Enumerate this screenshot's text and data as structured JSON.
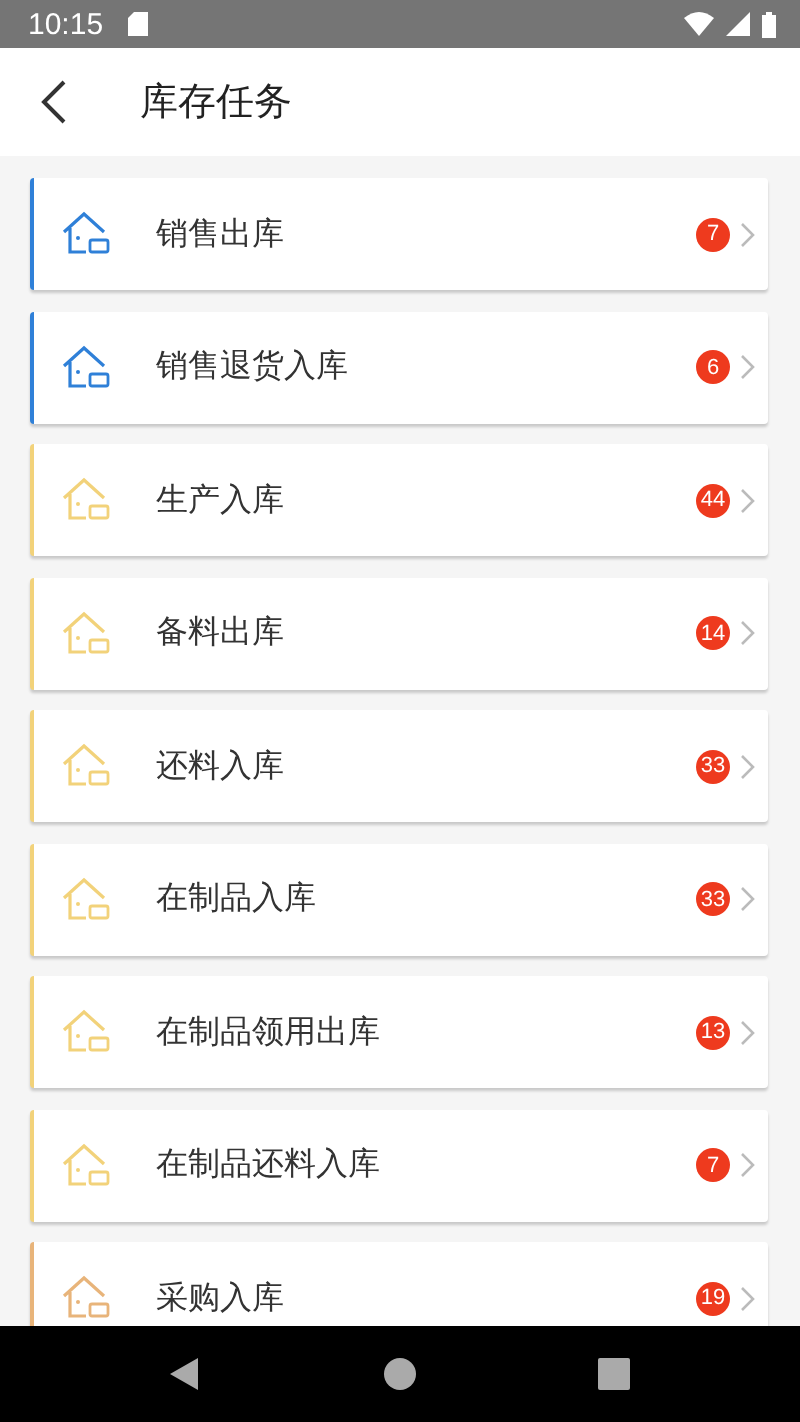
{
  "status_bar": {
    "time": "10:15"
  },
  "app_bar": {
    "title": "库存任务"
  },
  "tasks": [
    {
      "label": "销售出库",
      "count": "7",
      "color": "#2f80d8"
    },
    {
      "label": "销售退货入库",
      "count": "6",
      "color": "#2f80d8"
    },
    {
      "label": "生产入库",
      "count": "44",
      "color": "#f2d27a"
    },
    {
      "label": "备料出库",
      "count": "14",
      "color": "#f2d27a"
    },
    {
      "label": "还料入库",
      "count": "33",
      "color": "#f2d27a"
    },
    {
      "label": "在制品入库",
      "count": "33",
      "color": "#f2d27a"
    },
    {
      "label": "在制品领用出库",
      "count": "13",
      "color": "#f2d27a"
    },
    {
      "label": "在制品还料入库",
      "count": "7",
      "color": "#f2d27a"
    },
    {
      "label": "采购入库",
      "count": "19",
      "color": "#e8b47a"
    }
  ]
}
